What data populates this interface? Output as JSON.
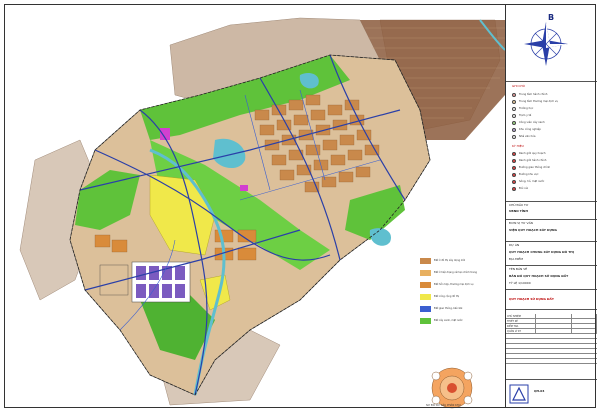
{
  "north_arrow": {
    "label": "B"
  },
  "colors": {
    "residential_new": "#c9894b",
    "residential_existing": "#dcc09a",
    "green_park": "#5fc23a",
    "green_dark": "#2e8b2e",
    "water": "#5fbfcf",
    "yellow_zone": "#f0e84a",
    "mountain": "#b79a80",
    "industrial": "#7b5bc0",
    "road": "#2a3fa8",
    "brown_hatched": "#8b5a3c",
    "magenta": "#d23fd0"
  },
  "map_legend": {
    "rows": [
      {
        "color": "#c9894b",
        "text": "Đất ở đô thị xây dựng mới"
      },
      {
        "color": "#e8b060",
        "text": "Đất ở hiện trạng cải tạo chỉnh trang"
      },
      {
        "color": "#d98b3a",
        "text": "Đất hỗn hợp, thương mại dịch vụ"
      },
      {
        "color": "#f0e84a",
        "text": "Đất công cộng đô thị"
      },
      {
        "color": "#3b5fd0",
        "text": "Đất giao thông, bến bãi"
      },
      {
        "color": "#5fc23a",
        "text": "Đất cây xanh, mặt nước"
      }
    ],
    "diagram_caption": "SƠ ĐỒ CƠ CẤU PHÂN KHU"
  },
  "titleblock": {
    "legend_title": "GHI CHÚ",
    "legend_items": [
      "Trung tâm hành chính",
      "Trung tâm thương mại dịch vụ",
      "Trường học",
      "Trạm y tế",
      "Công viên cây xanh",
      "Khu công nghiệp",
      "Nhà văn hóa"
    ],
    "symbols_title": "KÝ HIỆU",
    "symbol_items": [
      "Ranh giới quy hoạch",
      "Ranh giới hành chính",
      "Đường giao thông chính",
      "Đường khu vực",
      "Sông, hồ, mặt nước",
      "Đồi núi"
    ],
    "client_label": "CHỦ ĐẦU TƯ",
    "client_value": "UBND TỈNH",
    "consultant_label": "ĐƠN VỊ TƯ VẤN",
    "consultant_value": "VIỆN QUY HOẠCH XÂY DỰNG",
    "project_label": "DỰ ÁN",
    "project_value": "QUY HOẠCH CHUNG XÂY DỰNG ĐÔ THỊ",
    "location_label": "ĐỊA ĐIỂM",
    "drawing_label": "TÊN BẢN VẼ",
    "drawing_value": "BẢN ĐỒ QUY HOẠCH SỬ DỤNG ĐẤT",
    "drawing_sub": "TỶ LỆ 1/10000",
    "stamp_label": "QUY HOẠCH SỬ DỤNG ĐẤT",
    "sign_rows": [
      {
        "role": "CHỦ NHIỆM",
        "name": ""
      },
      {
        "role": "THIẾT KẾ",
        "name": ""
      },
      {
        "role": "KIỂM TRA",
        "name": ""
      },
      {
        "role": "QUẢN LÝ KT",
        "name": ""
      }
    ],
    "sheet_no": "QH-04"
  }
}
